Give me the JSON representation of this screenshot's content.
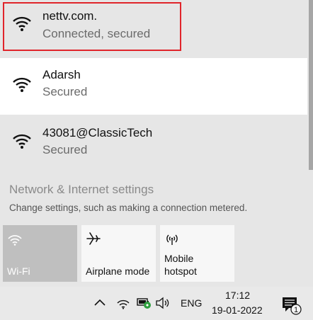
{
  "networks": [
    {
      "ssid": "nettv.com.",
      "status": "Connected, secured",
      "icon": "wifi-signal-icon"
    },
    {
      "ssid": "Adarsh",
      "status": "Secured",
      "icon": "wifi-signal-icon"
    },
    {
      "ssid": "43081@ClassicTech",
      "status": "Secured",
      "icon": "wifi-signal-icon"
    }
  ],
  "settings": {
    "title": "Network & Internet settings",
    "description": "Change settings, such as making a connection metered."
  },
  "quick_actions": [
    {
      "label": "Wi-Fi",
      "icon": "wifi-icon",
      "active": true
    },
    {
      "label": "Airplane mode",
      "icon": "airplane-icon",
      "active": false
    },
    {
      "label": "Mobile\nhotspot",
      "label_line1": "Mobile",
      "label_line2": "hotspot",
      "icon": "hotspot-icon",
      "active": false
    }
  ],
  "taskbar": {
    "language": "ENG",
    "time": "17:12",
    "date": "19-01-2022",
    "notification_count": "1"
  },
  "colors": {
    "highlight_border": "#e0252b",
    "active_tile": "#bfbfbf"
  }
}
